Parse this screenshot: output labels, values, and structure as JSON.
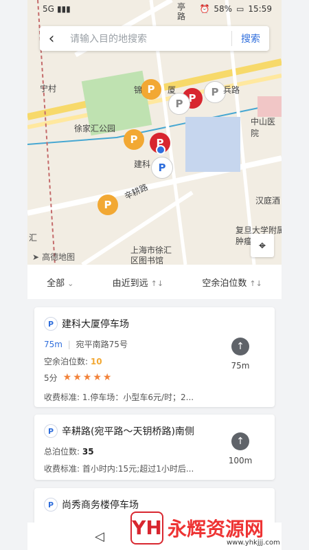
{
  "status_bar": {
    "left": "5G",
    "battery": "58%",
    "time": "15:59"
  },
  "search": {
    "placeholder": "请输入目的地搜索",
    "button": "搜索"
  },
  "map": {
    "labels": [
      "宁村",
      "徐家汇公园",
      "建科",
      "辛耕路",
      "中山医院",
      "汉庭酒",
      "复旦大学附属肿瘤医",
      "上海市徐汇区图书馆",
      "锦",
      "厦",
      "亭路",
      "兵路",
      "汇"
    ],
    "logo": "高德地图"
  },
  "filters": {
    "all": "全部",
    "sort": "由近到远",
    "spaces": "空余泊位数"
  },
  "parking": [
    {
      "name": "建科大厦停车场",
      "distance": "75m",
      "address": "宛平南路75号",
      "spaces_label": "空余泊位数:",
      "spaces_value": "10",
      "score": "5分",
      "fee_label": "收费标准:",
      "fee_value": "1.停车场：小型车6元/时；2...",
      "nav_distance": "75m"
    },
    {
      "name": "辛耕路(宛平路～天钥桥路)南侧",
      "total_label": "总泊位数:",
      "total_value": "35",
      "fee_label": "收费标准:",
      "fee_value": "首小时内:15元;超过1小时后...",
      "nav_distance": "100m"
    },
    {
      "name": "尚秀商务楼停车场"
    }
  ],
  "watermark": {
    "text": "永辉资源网",
    "url": "www.yhkjjj.com"
  }
}
